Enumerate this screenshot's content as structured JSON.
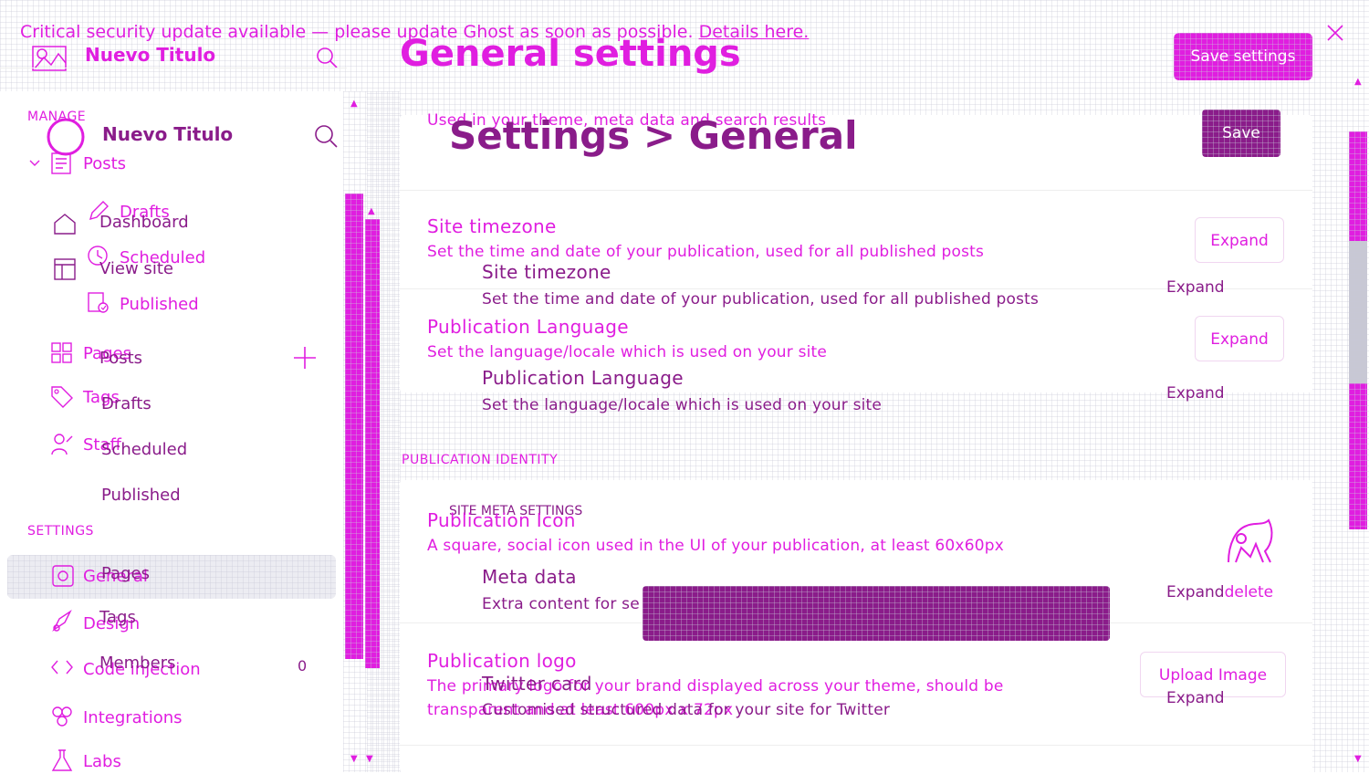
{
  "banner": {
    "text": "Critical security update available — please update Ghost as soon as possible.",
    "link": "Details here."
  },
  "sidebar": {
    "site_name": "Nuevo Titulo",
    "manage_label": "MANAGE",
    "settings_label": "SETTINGS",
    "manage_items": [
      {
        "label": "Posts",
        "icon": "posts-icon"
      },
      {
        "label": "Drafts",
        "icon": "pencil-icon"
      },
      {
        "label": "Scheduled",
        "icon": "clock-icon"
      },
      {
        "label": "Published",
        "icon": "published-icon"
      },
      {
        "label": "Pages",
        "icon": "pages-icon"
      },
      {
        "label": "Tags",
        "icon": "tag-icon"
      },
      {
        "label": "Staff",
        "icon": "staff-icon"
      }
    ],
    "settings_items": [
      {
        "label": "General",
        "icon": "general-icon"
      },
      {
        "label": "Design",
        "icon": "design-icon"
      },
      {
        "label": "Code injection",
        "icon": "code-icon"
      },
      {
        "label": "Integrations",
        "icon": "integrations-icon"
      },
      {
        "label": "Labs",
        "icon": "labs-icon"
      }
    ]
  },
  "ghost_sidebar": {
    "site_name": "Nuevo Titulo",
    "items": [
      "Dashboard",
      "View site",
      "Posts",
      "Drafts",
      "Scheduled",
      "Published",
      "Pages",
      "Tags",
      "Members"
    ],
    "members_count": "0"
  },
  "header": {
    "title": "General settings",
    "save_label": "Save settings"
  },
  "ghost_header": {
    "title": "Settings > General",
    "save_label": "Save"
  },
  "meta_section_desc": "Used in your theme, meta data and search results",
  "sections": [
    {
      "title": "Site timezone",
      "desc": "Set the time and date of your publication, used for all published posts",
      "button": "Expand"
    },
    {
      "title": "Publication Language",
      "desc": "Set the language/locale which is used on your site",
      "button": "Expand"
    }
  ],
  "ghost_sections": [
    {
      "title": "Site timezone",
      "desc": "Set the time and date of your publication, used for all published posts",
      "button": "Expand"
    },
    {
      "title": "Publication Language",
      "desc": "Set the language/locale which is used on your site",
      "button": "Expand"
    },
    {
      "title": "Meta data",
      "desc": "Extra content for se",
      "button": "Expand"
    },
    {
      "title": "Twitter card",
      "desc": "Customised structured data for your site for Twitter",
      "button": "Expand"
    }
  ],
  "identity": {
    "label": "PUBLICATION IDENTITY",
    "ghost_label": "SITE META SETTINGS",
    "icon_title": "Publication Icon",
    "icon_desc": "A square, social icon used in the UI of your publication, at least 60x60px",
    "delete_label": "delete",
    "logo_title": "Publication logo",
    "logo_desc_1": "The primary logo for your brand displayed across your theme, should be",
    "logo_desc_2": "transparent and at least 600px x 72px",
    "upload_label": "Upload Image"
  },
  "colors": {
    "accent": "#e01ee0",
    "dark_accent": "#8a1c8a",
    "scrollbar": "#e01ee0",
    "selected_row": "#ececf2"
  }
}
